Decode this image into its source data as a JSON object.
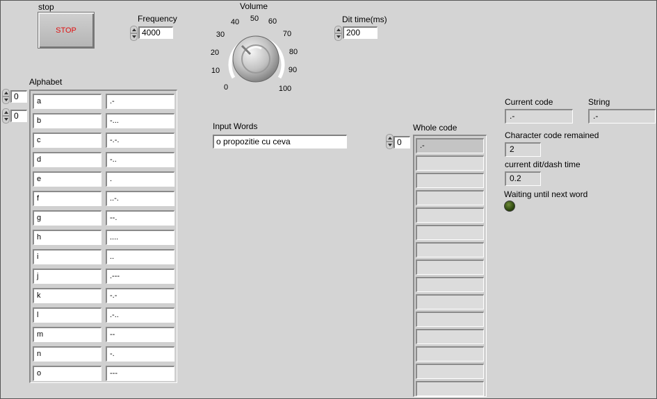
{
  "stop": {
    "label": "stop",
    "button_text": "STOP"
  },
  "frequency": {
    "label": "Frequency",
    "value": "4000"
  },
  "volume": {
    "label": "Volume",
    "ticks": [
      "0",
      "10",
      "20",
      "30",
      "40",
      "50",
      "60",
      "70",
      "80",
      "90",
      "100"
    ]
  },
  "dit_time": {
    "label": "Dit time(ms)",
    "value": "200"
  },
  "alphabet": {
    "label": "Alphabet",
    "index_row": "0",
    "index_col": "0",
    "letters": [
      "a",
      "b",
      "c",
      "d",
      "e",
      "f",
      "g",
      "h",
      "i",
      "j",
      "k",
      "l",
      "m",
      "n",
      "o"
    ],
    "codes": [
      ".-",
      "-...",
      "-.-.",
      "-..",
      ".",
      "..-.",
      "--.",
      "....",
      "..",
      ".---",
      "-.-",
      ".-..",
      "--",
      "-.",
      "---"
    ]
  },
  "input_words": {
    "label": "Input Words",
    "value": "o propozitie cu ceva"
  },
  "whole_code": {
    "label": "Whole code",
    "index": "0",
    "items": [
      ".-",
      "",
      "",
      "",
      "",
      "",
      "",
      "",
      "",
      "",
      "",
      "",
      "",
      "",
      ""
    ]
  },
  "current_code": {
    "label": "Current code",
    "value": ".-"
  },
  "string": {
    "label": "String",
    "value": ".-"
  },
  "char_code_remained": {
    "label": "Character code remained",
    "value": "2"
  },
  "dit_dash_time": {
    "label": "current dit/dash time",
    "value": "0.2"
  },
  "waiting": {
    "label": "Waiting until next word",
    "led_color": "#2f4a10"
  },
  "colors": {
    "background": "#d4d4d4",
    "stop_text": "#e01010"
  }
}
